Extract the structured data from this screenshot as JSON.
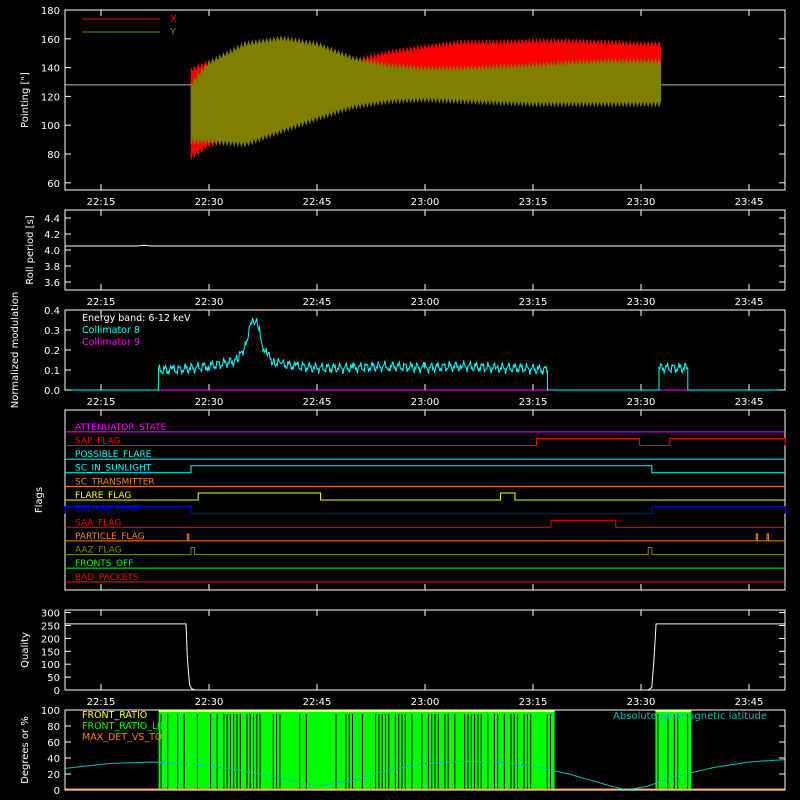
{
  "colors": {
    "background": "#000000",
    "axis": "#ffffff",
    "x_series": "#ff0000",
    "y_series": "#808000",
    "collimator8": "#00ffff",
    "collimator9": "#ff00ff",
    "front_ratio": "#ffff00",
    "front_ratio_line": "#00ff00",
    "max_det": "#ff8000",
    "latitude": "#00c0c0"
  },
  "time_axis": {
    "range_min": [
      0,
      100
    ],
    "tick_labels": [
      "22:15",
      "22:30",
      "22:45",
      "23:00",
      "23:15",
      "23:30",
      "23:45"
    ],
    "tick_positions_min": [
      5,
      20,
      35,
      50,
      65,
      80,
      95
    ]
  },
  "chart_data": [
    {
      "type": "area",
      "name": "pointing",
      "ylabel": "Pointing [\"]",
      "ylim": [
        55,
        180
      ],
      "yticks": [
        60,
        80,
        100,
        120,
        140,
        160,
        180
      ],
      "legend": [
        "X",
        "Y"
      ],
      "legend_placement": "top-left",
      "baseline_value": 128,
      "data_window_min": [
        17.5,
        82.8
      ],
      "series": [
        {
          "name": "X",
          "x_min": [
            17.5,
            20,
            25,
            30,
            35,
            40,
            45,
            50,
            55,
            60,
            65,
            70,
            75,
            80,
            82.8
          ],
          "upper": [
            140,
            145,
            152,
            155,
            150,
            146,
            152,
            156,
            159,
            159,
            160,
            160,
            159,
            158,
            158
          ],
          "lower": [
            76,
            85,
            90,
            97,
            108,
            117,
            123,
            126,
            127,
            127,
            127,
            126,
            126,
            126,
            126
          ]
        },
        {
          "name": "Y",
          "x_min": [
            17.5,
            20,
            25,
            30,
            35,
            40,
            45,
            50,
            55,
            60,
            65,
            70,
            75,
            80,
            82.8
          ],
          "upper": [
            130,
            145,
            158,
            162,
            158,
            148,
            143,
            141,
            141,
            142,
            143,
            145,
            146,
            146,
            146
          ],
          "lower": [
            87,
            87,
            85,
            94,
            103,
            111,
            115,
            116,
            115,
            114,
            113,
            113,
            113,
            113,
            113
          ]
        }
      ]
    },
    {
      "type": "line",
      "name": "roll_period",
      "ylabel": "Roll period [s]",
      "ylim": [
        3.5,
        4.5
      ],
      "yticks": [
        3.6,
        3.8,
        4.0,
        4.2,
        4.4
      ],
      "tick_labels": [
        "3.6",
        "3.8",
        "4.0",
        "4.2",
        "4.4"
      ],
      "series": [
        {
          "name": "roll",
          "x": [
            0,
            10,
            11,
            12,
            100
          ],
          "y": [
            4.05,
            4.05,
            4.06,
            4.05,
            4.05
          ]
        }
      ]
    },
    {
      "type": "line",
      "name": "modulation",
      "ylabel": "Normalized modulation",
      "ylim": [
        0,
        0.4
      ],
      "yticks": [
        0.0,
        0.1,
        0.2,
        0.3,
        0.4
      ],
      "tick_labels": [
        "0.0",
        "0.1",
        "0.2",
        "0.3",
        "0.4"
      ],
      "annotation": "Energy band: 6-12 keV",
      "legend": [
        "Collimator 8",
        "Collimator 9"
      ],
      "series": [
        {
          "name": "Collimator 8",
          "x": [
            0,
            13.0,
            13.0,
            15,
            18,
            20,
            23,
            24,
            25,
            25.8,
            26.5,
            27,
            27.5,
            28,
            29,
            30,
            32,
            35,
            40,
            45,
            50,
            55,
            60,
            63,
            67.0,
            67.0,
            82.5,
            82.5,
            86.5,
            86.5,
            100
          ],
          "y": [
            0,
            0,
            0.1,
            0.1,
            0.11,
            0.12,
            0.14,
            0.15,
            0.22,
            0.33,
            0.34,
            0.3,
            0.22,
            0.18,
            0.14,
            0.13,
            0.12,
            0.11,
            0.11,
            0.12,
            0.11,
            0.12,
            0.11,
            0.11,
            0.1,
            0,
            0,
            0.11,
            0.11,
            0,
            0
          ]
        },
        {
          "name": "Collimator 9",
          "x": [
            0,
            100
          ],
          "y": [
            0,
            0
          ]
        }
      ]
    },
    {
      "type": "line",
      "name": "flags",
      "ylabel": "Flags",
      "labels": [
        "ATTENUATOR_STATE",
        "SAP_FLAG",
        "POSSIBLE_FLARE",
        "SC_IN_SUNLIGHT",
        "SC_TRANSMITTER",
        "FLARE_FLAG",
        "ECLIPSE_FLAG",
        "SAA_FLAG",
        "PARTICLE_FLAG",
        "AAZ_FLAG",
        "FRONTS_OFF",
        "BAD_PACKETS"
      ],
      "flag_colors": [
        "#ff00ff",
        "#ff0000",
        "#00ffff",
        "#00ffff",
        "#ff8000",
        "#ffff00",
        "#0000ff",
        "#ff0000",
        "#ff8000",
        "#808000",
        "#00ff00",
        "#ff0000"
      ],
      "series": [
        {
          "name": "ATTENUATOR_STATE",
          "on_intervals": []
        },
        {
          "name": "SAP_FLAG",
          "on_intervals": [
            [
              65.5,
              79.8
            ],
            [
              84.0,
              100
            ]
          ]
        },
        {
          "name": "POSSIBLE_FLARE",
          "on_intervals": []
        },
        {
          "name": "SC_IN_SUNLIGHT",
          "on_intervals": [
            [
              17.5,
              81.5
            ]
          ]
        },
        {
          "name": "SC_TRANSMITTER",
          "on_intervals": []
        },
        {
          "name": "FLARE_FLAG",
          "on_intervals": [
            [
              18.5,
              35.5
            ],
            [
              60.5,
              62.5
            ]
          ]
        },
        {
          "name": "ECLIPSE_FLAG",
          "on_intervals": [
            [
              0,
              17.5
            ],
            [
              81.5,
              100
            ]
          ]
        },
        {
          "name": "SAA_FLAG",
          "on_intervals": [
            [
              67.5,
              76.5
            ]
          ]
        },
        {
          "name": "PARTICLE_FLAG",
          "on_intervals": [
            [
              17.0,
              17.2
            ],
            [
              96.0,
              96.2
            ],
            [
              97.5,
              97.7
            ]
          ]
        },
        {
          "name": "AAZ_FLAG",
          "on_intervals": [
            [
              17.5,
              18.0
            ],
            [
              81.0,
              81.5
            ]
          ]
        },
        {
          "name": "FRONTS_OFF",
          "on_intervals": []
        },
        {
          "name": "BAD_PACKETS",
          "on_intervals": []
        }
      ]
    },
    {
      "type": "line",
      "name": "quality",
      "ylabel": "Quality",
      "ylim": [
        0,
        310
      ],
      "yticks": [
        0,
        50,
        100,
        150,
        200,
        250,
        300
      ],
      "series": [
        {
          "name": "quality",
          "x": [
            0,
            16.8,
            17.0,
            17.3,
            17.6,
            18,
            81,
            81.5,
            81.8,
            82.1,
            100
          ],
          "y": [
            256,
            256,
            120,
            20,
            5,
            0,
            0,
            10,
            120,
            256,
            256
          ]
        }
      ]
    },
    {
      "type": "bar",
      "name": "front_ratio",
      "ylabel": "Degrees or %",
      "ylim": [
        0,
        100
      ],
      "yticks": [
        0,
        20,
        40,
        60,
        80,
        100
      ],
      "legend": [
        "FRONT_RATIO",
        "FRONT_RATIO_LINE",
        "MAX_DET_VS_TOT"
      ],
      "annotation": "Absolute geomagnetic latitude",
      "active_window_min": [
        [
          13,
          68
        ],
        [
          82,
          87
        ]
      ],
      "latitude_series": {
        "x": [
          0,
          6,
          12,
          18,
          24,
          30,
          35,
          40,
          45,
          50,
          55,
          60,
          65,
          70,
          75,
          78,
          81,
          84,
          90,
          95,
          100
        ],
        "y": [
          27,
          33,
          35,
          33,
          25,
          15,
          5,
          12,
          25,
          33,
          36,
          35,
          30,
          20,
          7,
          0,
          5,
          15,
          28,
          35,
          38
        ]
      }
    }
  ]
}
